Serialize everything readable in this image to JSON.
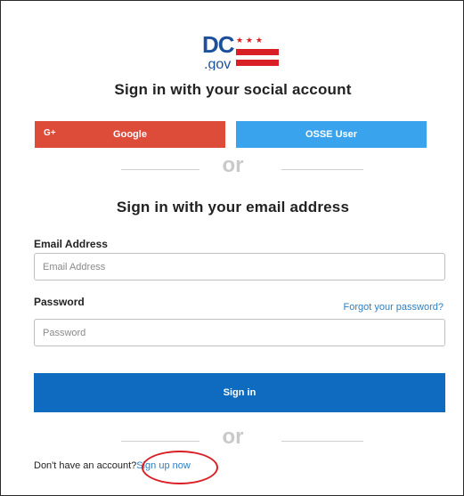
{
  "logo": {
    "text_dc": "DC",
    "text_gov": ".gov",
    "stars": "★ ★ ★"
  },
  "social": {
    "title": "Sign in with your social account",
    "google_icon": "G+",
    "google_label": "Google",
    "osse_label": "OSSE User"
  },
  "divider_text": "or",
  "email_form": {
    "title": "Sign in with your email address",
    "email_label": "Email Address",
    "email_placeholder": "Email Address",
    "email_value": "",
    "password_label": "Password",
    "password_placeholder": "Password",
    "password_value": "",
    "forgot_label": "Forgot your password?",
    "signin_label": "Sign in"
  },
  "signup": {
    "prompt": "Don't have an account?",
    "link_label": "Sign up now"
  },
  "colors": {
    "google": "#dd4b39",
    "osse": "#3aa3ee",
    "primary": "#0f6bbf",
    "link": "#2d7fc1",
    "dc_flag_red": "#d81f26",
    "dc_blue": "#1c4f9c",
    "annotation_circle": "#d81f26"
  }
}
